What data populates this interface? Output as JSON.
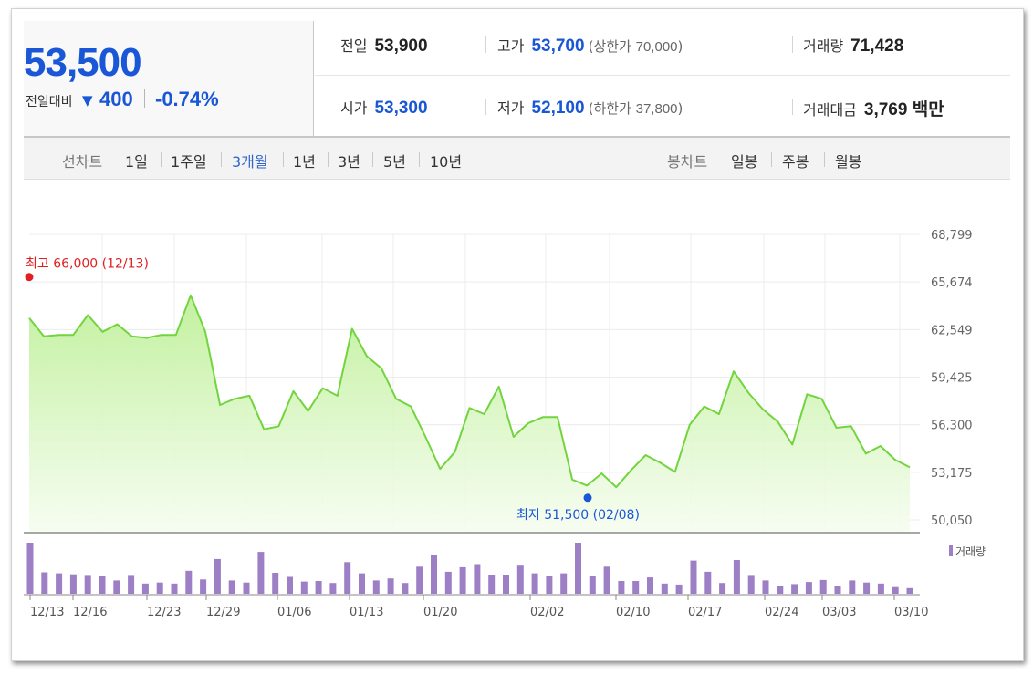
{
  "summary": {
    "price": "53,500",
    "compare_label": "전일대비",
    "compare_arrow": "▼",
    "change": "400",
    "change_rate": "-0.74%"
  },
  "info": {
    "prev_close": {
      "label": "전일",
      "value": "53,900"
    },
    "high": {
      "label": "고가",
      "value": "53,700",
      "limit_label": "상한가",
      "limit_value": "70,000"
    },
    "volume": {
      "label": "거래량",
      "value": "71,428"
    },
    "open": {
      "label": "시가",
      "value": "53,300"
    },
    "low": {
      "label": "저가",
      "value": "52,100",
      "limit_label": "하한가",
      "limit_value": "37,800"
    },
    "amount": {
      "label": "거래대금",
      "value": "3,769 백만"
    }
  },
  "line_tabs": {
    "label": "선차트",
    "items": [
      "1일",
      "1주일",
      "3개월",
      "1년",
      "3년",
      "5년",
      "10년"
    ],
    "active": "3개월"
  },
  "candle_tabs": {
    "label": "봉차트",
    "items": [
      "일봉",
      "주봉",
      "월봉"
    ]
  },
  "colors": {
    "accent": "#1a57d6",
    "line": "#72d43e",
    "volume": "#9d7fc5",
    "high": "#e02020",
    "low": "#1a57d6"
  },
  "chart_data": [
    {
      "type": "area",
      "title": "",
      "xlabel": "",
      "ylabel": "",
      "ylim": [
        50050,
        68799
      ],
      "yticks": [
        "68,799",
        "65,674",
        "62,549",
        "59,425",
        "56,300",
        "53,175",
        "50,050"
      ],
      "xticks": [
        "12/13",
        "12/16",
        "12/23",
        "12/29",
        "01/06",
        "01/13",
        "01/20",
        "02/02",
        "02/10",
        "02/17",
        "02/24",
        "03/03",
        "03/10"
      ],
      "grid": true,
      "annotations": {
        "high": {
          "text": "최고 66,000 (12/13)",
          "value": 66000
        },
        "low": {
          "text": "최저 51,500 (02/08)",
          "value": 51500
        }
      },
      "series": [
        {
          "values": [
            63300,
            62100,
            62200,
            62200,
            63500,
            62400,
            62900,
            62100,
            62000,
            62200,
            62200,
            64800,
            62400,
            57600,
            58000,
            58200,
            56000,
            56200,
            58500,
            57200,
            58700,
            58200,
            62600,
            60800,
            60000,
            58000,
            57500,
            55500,
            53400,
            54500,
            57400,
            57000,
            58800,
            55500,
            56400,
            56800,
            56800,
            52700,
            52300,
            53100,
            52200,
            53300,
            54300,
            53800,
            53200,
            56300,
            57500,
            57000,
            59800,
            58400,
            57300,
            56500,
            55000,
            58300,
            58000,
            56100,
            56200,
            54400,
            54900,
            54000,
            53500
          ]
        }
      ]
    },
    {
      "type": "bar",
      "title": "",
      "legend": "거래량",
      "legend_position": "top-right",
      "values": [
        100,
        42,
        40,
        38,
        35,
        34,
        26,
        35,
        20,
        22,
        20,
        45,
        28,
        68,
        26,
        22,
        82,
        41,
        33,
        24,
        25,
        21,
        62,
        40,
        26,
        30,
        21,
        53,
        75,
        43,
        52,
        58,
        36,
        37,
        55,
        40,
        34,
        40,
        100,
        34,
        53,
        25,
        25,
        32,
        20,
        18,
        65,
        43,
        21,
        66,
        35,
        26,
        16,
        19,
        23,
        27,
        16,
        26,
        22,
        20,
        13,
        11
      ]
    }
  ]
}
